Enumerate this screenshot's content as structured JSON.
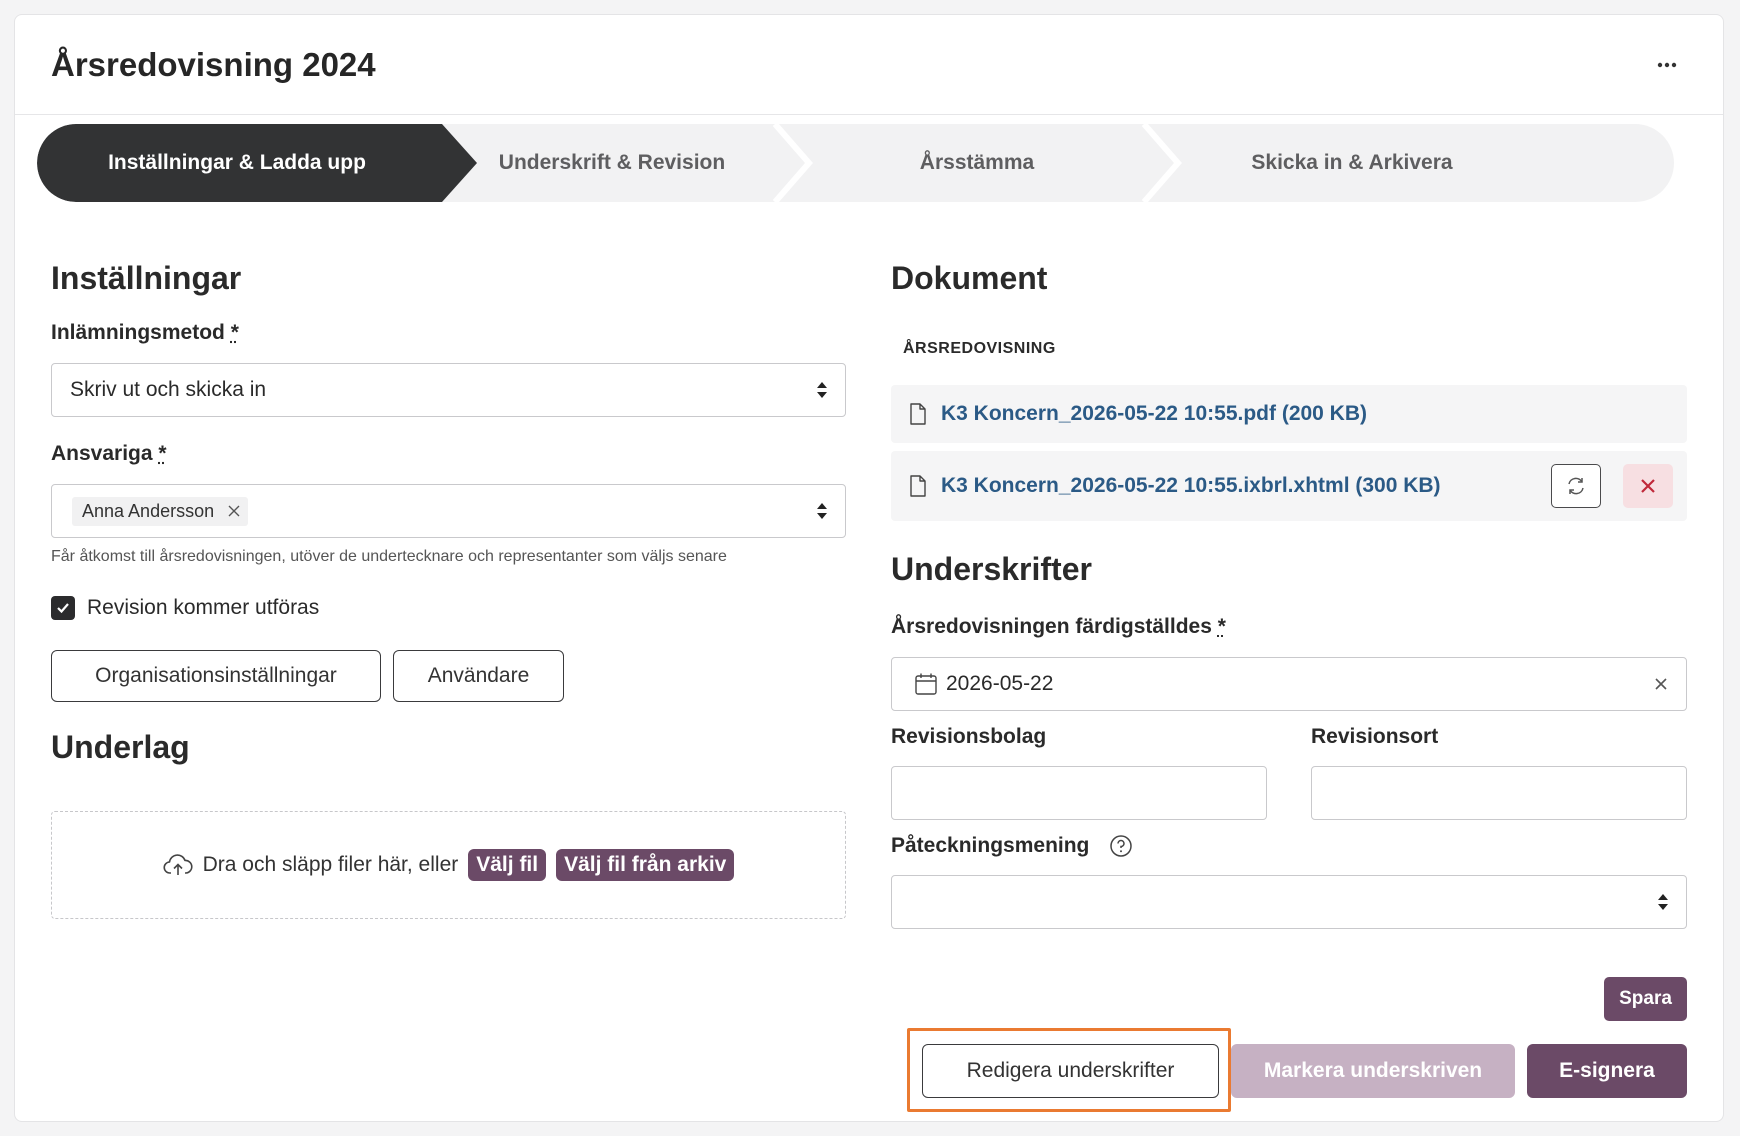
{
  "header": {
    "title": "Årsredovisning 2024",
    "more_icon": "more-horizontal-icon"
  },
  "stepper": {
    "steps": [
      {
        "label": "Inställningar & Ladda upp",
        "active": true
      },
      {
        "label": "Underskrift & Revision",
        "active": false
      },
      {
        "label": "Årsstämma",
        "active": false
      },
      {
        "label": "Skicka in & Arkivera",
        "active": false
      }
    ]
  },
  "settings": {
    "heading": "Inställningar",
    "method_label": "Inlämningsmetod",
    "required_mark": "*",
    "method_value": "Skriv ut och skicka in",
    "responsible_label": "Ansvariga",
    "responsible_chip": "Anna Andersson",
    "responsible_help": "Får åtkomst till årsredovisningen, utöver de undertecknare och representanter som väljs senare",
    "revision_checkbox_label": "Revision kommer utföras",
    "revision_checked": true,
    "org_settings_button": "Organisationsinställningar",
    "users_button": "Användare"
  },
  "underlag": {
    "heading": "Underlag",
    "drop_text": "Dra och släpp filer här, eller",
    "choose_file": "Välj fil",
    "choose_from_archive": "Välj fil från arkiv"
  },
  "documents": {
    "heading": "Dokument",
    "section_label": "ÅRSREDOVISNING",
    "files": [
      {
        "name": "K3 Koncern_2026-05-22 10:55.pdf (200 KB)"
      },
      {
        "name": "K3 Koncern_2026-05-22 10:55.ixbrl.xhtml (300 KB)"
      }
    ]
  },
  "signatures": {
    "heading": "Underskrifter",
    "completed_label": "Årsredovisningen färdigställdes",
    "required_mark": "*",
    "completed_date": "2026-05-22",
    "audit_firm_label": "Revisionsbolag",
    "audit_firm_value": "",
    "audit_city_label": "Revisionsort",
    "audit_city_value": "",
    "endorsement_label": "Påteckningsmening",
    "endorsement_value": "",
    "save_button": "Spara",
    "edit_signatures_button": "Redigera underskrifter",
    "mark_signed_button": "Markera underskriven",
    "esign_button": "E-signera"
  },
  "colors": {
    "brand": "#6b4a67",
    "brand_disabled": "#c6b1c3",
    "link": "#2b5a86",
    "highlight": "#ea7a31",
    "stepper_active": "#323334"
  }
}
